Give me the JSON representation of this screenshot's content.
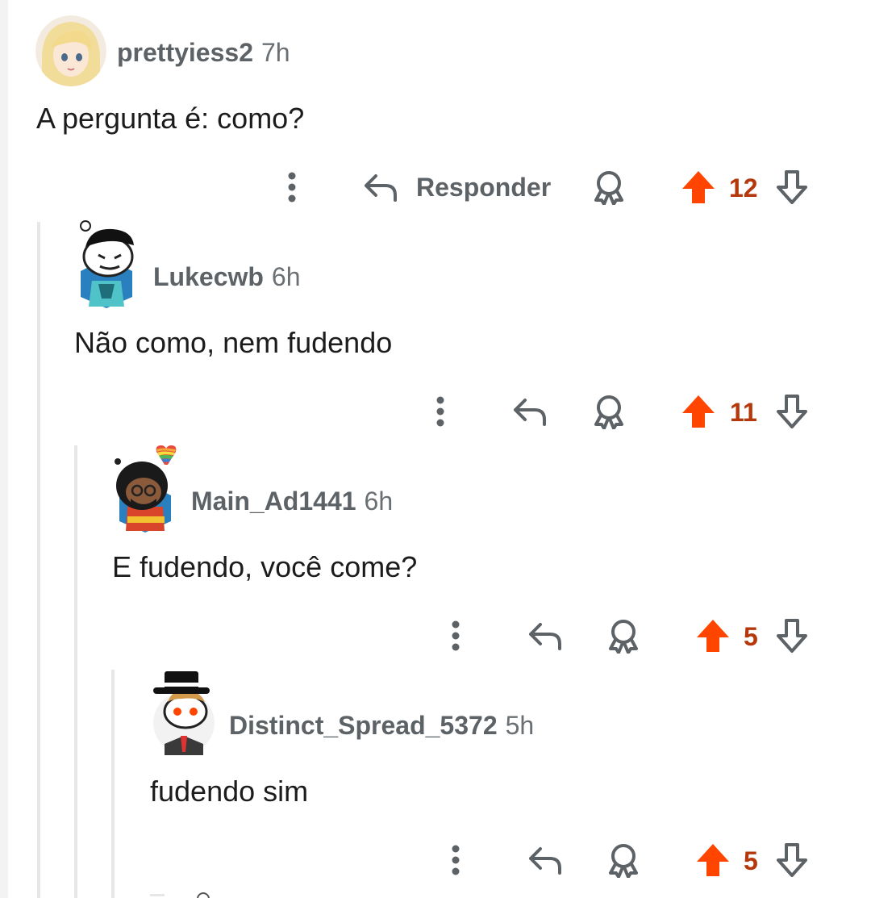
{
  "comments": [
    {
      "author": "prettyiess2",
      "time": "7h",
      "body": "A pergunta é: como?",
      "reply_label": "Responder",
      "score": "12"
    },
    {
      "author": "Lukecwb",
      "time": "6h",
      "body": "Não como, nem fudendo",
      "score": "11"
    },
    {
      "author": "Main_Ad1441",
      "time": "6h",
      "body": "E fudendo, você come?",
      "score": "5"
    },
    {
      "author": "Distinct_Spread_5372",
      "time": "5h",
      "body": "fudendo sim",
      "score": "5"
    }
  ],
  "icons": {
    "more": "more-vertical-icon",
    "reply": "reply-arrow-icon",
    "award": "award-icon",
    "upvote": "upvote-arrow-icon",
    "downvote": "downvote-arrow-icon"
  },
  "colors": {
    "upvote": "#ff4500",
    "score": "#b4380b",
    "meta": "#5d6266",
    "thread_line": "#e7e7e7"
  }
}
